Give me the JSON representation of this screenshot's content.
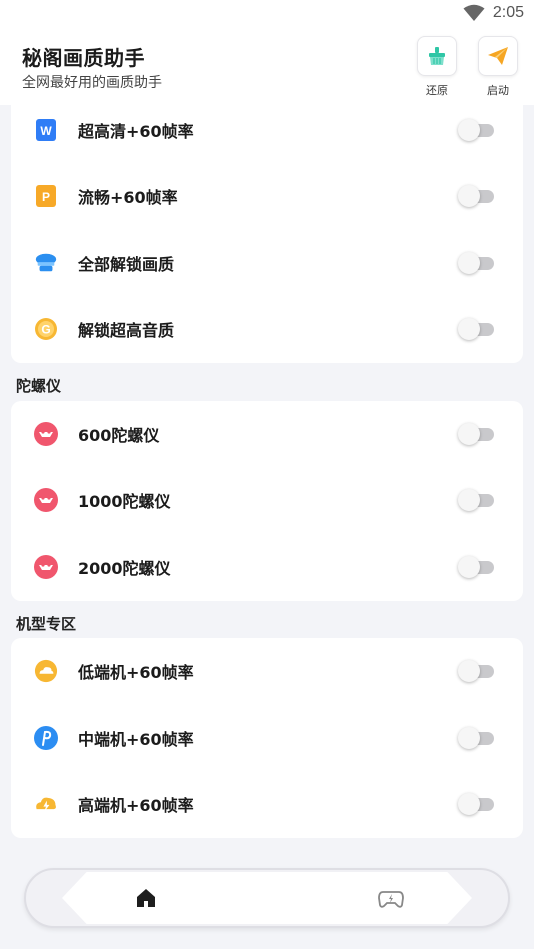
{
  "status_bar": {
    "time": "2:05"
  },
  "header": {
    "title": "秘阁画质助手",
    "subtitle": "全网最好用的画质助手",
    "restore_label": "还原",
    "start_label": "启动"
  },
  "sections": [
    {
      "title": "",
      "items": [
        {
          "label": "超高清+60帧率",
          "icon": "wps-doc-icon",
          "enabled": false
        },
        {
          "label": "流畅+60帧率",
          "icon": "ppt-icon",
          "enabled": false
        },
        {
          "label": "全部解锁画质",
          "icon": "chef-hat-icon",
          "enabled": false
        },
        {
          "label": "解锁超高音质",
          "icon": "g-coin-icon",
          "enabled": false
        }
      ]
    },
    {
      "title": "陀螺仪",
      "items": [
        {
          "label": "600陀螺仪",
          "icon": "gyroscope-icon",
          "enabled": false
        },
        {
          "label": "1000陀螺仪",
          "icon": "gyroscope-icon",
          "enabled": false
        },
        {
          "label": "2000陀螺仪",
          "icon": "gyroscope-icon",
          "enabled": false
        }
      ]
    },
    {
      "title": "机型专区",
      "items": [
        {
          "label": "低端机+60帧率",
          "icon": "cloud-icon",
          "enabled": false
        },
        {
          "label": "中端机+60帧率",
          "icon": "p-badge-icon",
          "enabled": false
        },
        {
          "label": "高端机+60帧率",
          "icon": "cloud-bolt-icon",
          "enabled": false
        }
      ]
    }
  ],
  "bottom_nav": {
    "items": [
      "home-icon",
      "game-controller-icon"
    ]
  },
  "colors": {
    "background": "#f3f4f8",
    "toggle_off": "#c9c9cc",
    "restore_accent": "#2fc6a6",
    "start_accent": "#f6a623"
  }
}
